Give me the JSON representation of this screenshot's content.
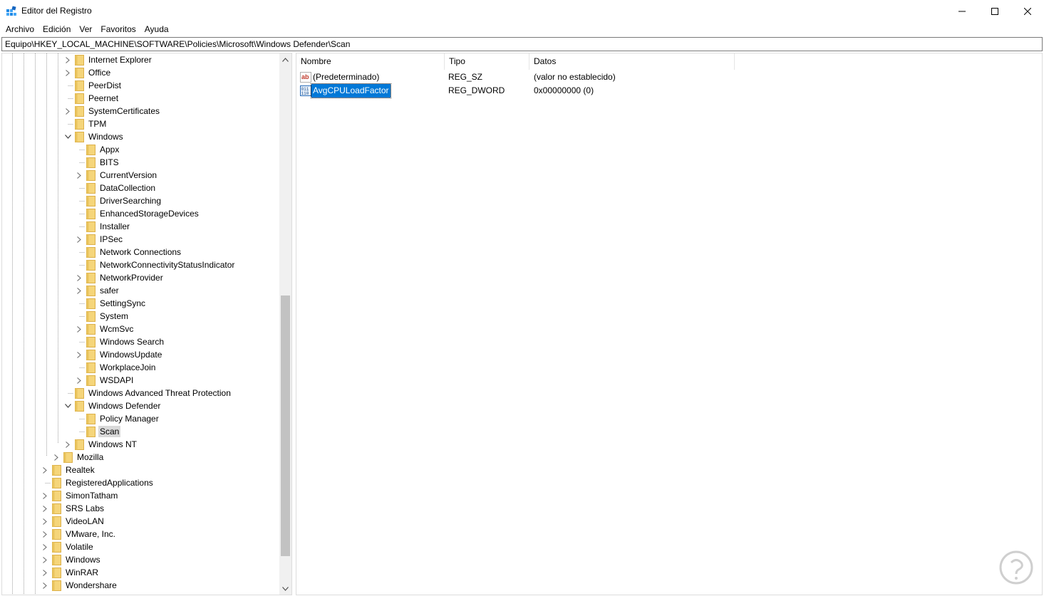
{
  "window": {
    "title": "Editor del Registro",
    "controls": {
      "minimize": "minimize-icon",
      "maximize": "maximize-icon",
      "close": "close-icon"
    }
  },
  "menu": [
    "Archivo",
    "Edición",
    "Ver",
    "Favoritos",
    "Ayuda"
  ],
  "address": "Equipo\\HKEY_LOCAL_MACHINE\\SOFTWARE\\Policies\\Microsoft\\Windows Defender\\Scan",
  "tree": [
    {
      "label": "Internet Explorer",
      "level": 3,
      "expander": "collapsed"
    },
    {
      "label": "Office",
      "level": 3,
      "expander": "collapsed"
    },
    {
      "label": "PeerDist",
      "level": 3,
      "expander": "none"
    },
    {
      "label": "Peernet",
      "level": 3,
      "expander": "none"
    },
    {
      "label": "SystemCertificates",
      "level": 3,
      "expander": "collapsed"
    },
    {
      "label": "TPM",
      "level": 3,
      "expander": "none"
    },
    {
      "label": "Windows",
      "level": 3,
      "expander": "expanded"
    },
    {
      "label": "Appx",
      "level": 4,
      "expander": "none"
    },
    {
      "label": "BITS",
      "level": 4,
      "expander": "none"
    },
    {
      "label": "CurrentVersion",
      "level": 4,
      "expander": "collapsed"
    },
    {
      "label": "DataCollection",
      "level": 4,
      "expander": "none"
    },
    {
      "label": "DriverSearching",
      "level": 4,
      "expander": "none"
    },
    {
      "label": "EnhancedStorageDevices",
      "level": 4,
      "expander": "none"
    },
    {
      "label": "Installer",
      "level": 4,
      "expander": "none"
    },
    {
      "label": "IPSec",
      "level": 4,
      "expander": "collapsed"
    },
    {
      "label": "Network Connections",
      "level": 4,
      "expander": "none"
    },
    {
      "label": "NetworkConnectivityStatusIndicator",
      "level": 4,
      "expander": "none"
    },
    {
      "label": "NetworkProvider",
      "level": 4,
      "expander": "collapsed"
    },
    {
      "label": "safer",
      "level": 4,
      "expander": "collapsed"
    },
    {
      "label": "SettingSync",
      "level": 4,
      "expander": "none"
    },
    {
      "label": "System",
      "level": 4,
      "expander": "none"
    },
    {
      "label": "WcmSvc",
      "level": 4,
      "expander": "collapsed"
    },
    {
      "label": "Windows Search",
      "level": 4,
      "expander": "none"
    },
    {
      "label": "WindowsUpdate",
      "level": 4,
      "expander": "collapsed"
    },
    {
      "label": "WorkplaceJoin",
      "level": 4,
      "expander": "none"
    },
    {
      "label": "WSDAPI",
      "level": 4,
      "expander": "collapsed"
    },
    {
      "label": "Windows Advanced Threat Protection",
      "level": 3,
      "expander": "none"
    },
    {
      "label": "Windows Defender",
      "level": 3,
      "expander": "expanded"
    },
    {
      "label": "Policy Manager",
      "level": 4,
      "expander": "none"
    },
    {
      "label": "Scan",
      "level": 4,
      "expander": "none",
      "selected": true
    },
    {
      "label": "Windows NT",
      "level": 3,
      "expander": "collapsed"
    },
    {
      "label": "Mozilla",
      "level": 2,
      "expander": "collapsed"
    },
    {
      "label": "Realtek",
      "level": 1,
      "expander": "collapsed"
    },
    {
      "label": "RegisteredApplications",
      "level": 1,
      "expander": "none"
    },
    {
      "label": "SimonTatham",
      "level": 1,
      "expander": "collapsed"
    },
    {
      "label": "SRS Labs",
      "level": 1,
      "expander": "collapsed"
    },
    {
      "label": "VideoLAN",
      "level": 1,
      "expander": "collapsed"
    },
    {
      "label": "VMware, Inc.",
      "level": 1,
      "expander": "collapsed"
    },
    {
      "label": "Volatile",
      "level": 1,
      "expander": "collapsed"
    },
    {
      "label": "Windows",
      "level": 1,
      "expander": "collapsed"
    },
    {
      "label": "WinRAR",
      "level": 1,
      "expander": "collapsed"
    },
    {
      "label": "Wondershare",
      "level": 1,
      "expander": "collapsed"
    }
  ],
  "list": {
    "columns": [
      "Nombre",
      "Tipo",
      "Datos"
    ],
    "rows": [
      {
        "icon": "string-value-icon",
        "name": "(Predeterminado)",
        "type": "REG_SZ",
        "data": "(valor no establecido)",
        "selected": false
      },
      {
        "icon": "binary-value-icon",
        "name": "AvgCPULoadFactor",
        "type": "REG_DWORD",
        "data": "0x00000000 (0)",
        "selected": true
      }
    ]
  },
  "colors": {
    "folder": "#f5d57a",
    "folder_edge": "#dcb04a",
    "selection_blue": "#0078d7",
    "tree_selected": "#d9d9d9",
    "guide": "#a0a0a0"
  }
}
